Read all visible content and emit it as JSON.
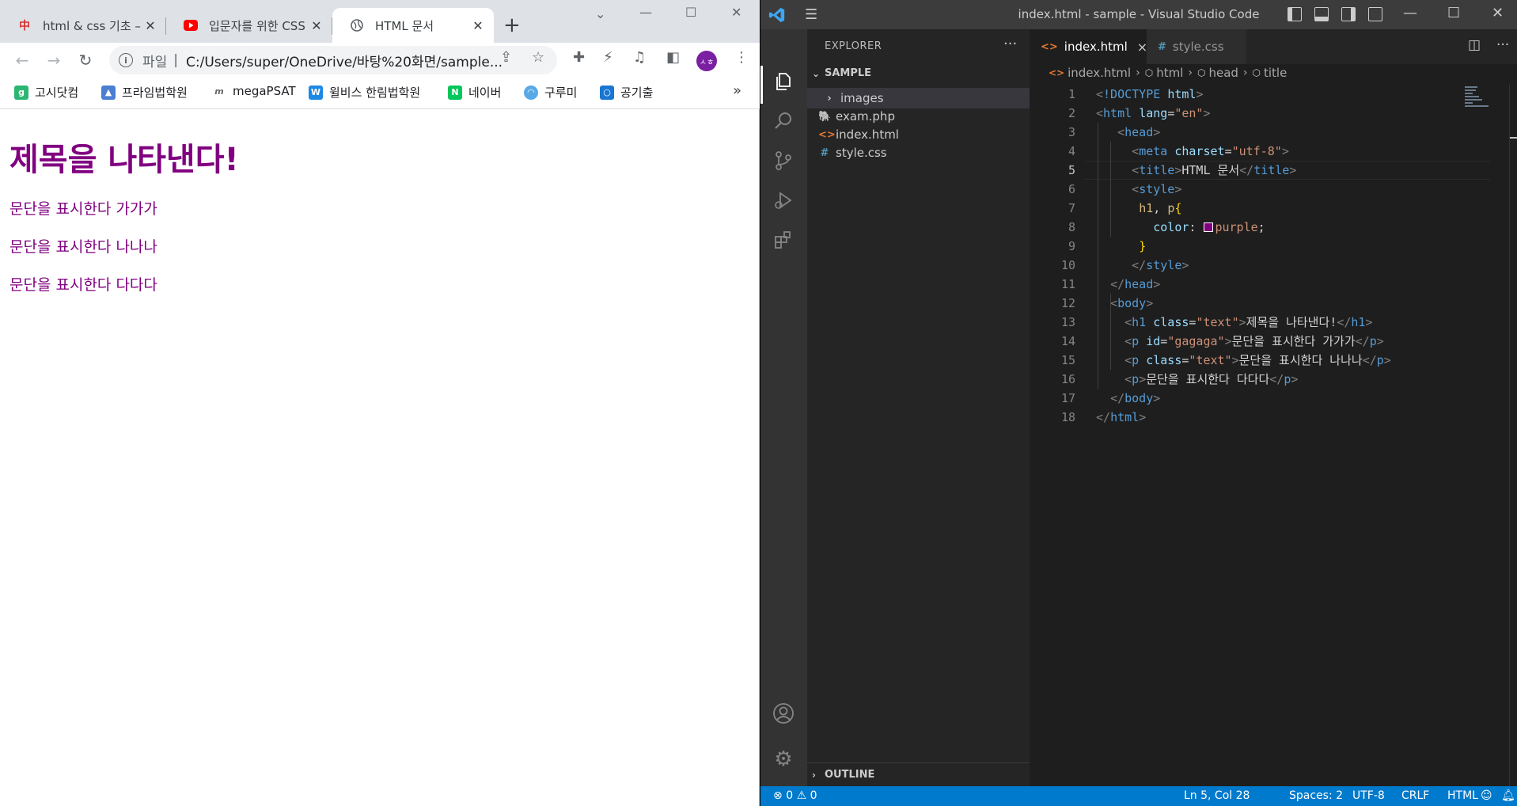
{
  "browser": {
    "tabs": [
      {
        "title": "html & css 기초 –",
        "favicon": "chinese-char-icon",
        "active": false
      },
      {
        "title": "입문자를 위한 CSS",
        "favicon": "youtube-icon",
        "active": false
      },
      {
        "title": "HTML 문서",
        "favicon": "globe-icon",
        "active": true
      }
    ],
    "address": {
      "scheme": "파일",
      "url": "C:/Users/super/OneDrive/바탕%20화면/sample..."
    },
    "avatar_text": "ㅅㅎ",
    "bookmarks": [
      {
        "label": "고시닷컴",
        "icon": "goshi-icon",
        "color": "#2bb673"
      },
      {
        "label": "프라임법학원",
        "icon": "prime-icon",
        "color": "#4a7fd1"
      },
      {
        "label": "megaPSAT",
        "icon": "mega-icon",
        "color": "#666666"
      },
      {
        "label": "윌비스 한림법학원",
        "icon": "willbes-icon",
        "color": "#1e88e5"
      },
      {
        "label": "네이버",
        "icon": "naver-icon",
        "color": "#03c75a"
      },
      {
        "label": "구루미",
        "icon": "gooroomee-icon",
        "color": "#5aa9e6"
      },
      {
        "label": "공기출",
        "icon": "gonggi-icon",
        "color": "#1976d2"
      }
    ],
    "bookmarks_more": "»",
    "page": {
      "heading": "제목을 나타낸다!",
      "paragraphs": [
        "문단을 표시한다 가가가",
        "문단을 표시한다 나나나",
        "문단을 표시한다 다다다"
      ],
      "text_color": "#800080"
    }
  },
  "vscode": {
    "window_title": "index.html - sample - Visual Studio Code",
    "explorer": {
      "title": "EXPLORER",
      "folder": "SAMPLE",
      "items": [
        {
          "label": "images",
          "type": "folder"
        },
        {
          "label": "exam.php",
          "type": "php"
        },
        {
          "label": "index.html",
          "type": "html"
        },
        {
          "label": "style.css",
          "type": "css"
        }
      ],
      "outline": "OUTLINE"
    },
    "tabs": [
      {
        "label": "index.html",
        "active": true,
        "close": "×"
      },
      {
        "label": "style.css",
        "active": false
      }
    ],
    "breadcrumb": [
      "index.html",
      "html",
      "head",
      "title"
    ],
    "line_numbers": [
      "1",
      "2",
      "3",
      "4",
      "5",
      "6",
      "7",
      "8",
      "9",
      "10",
      "11",
      "12",
      "13",
      "14",
      "15",
      "16",
      "17",
      "18"
    ],
    "statusbar": {
      "errors": "0",
      "warnings": "0",
      "position": "Ln 5, Col 28",
      "spaces": "Spaces: 2",
      "encoding": "UTF-8",
      "eol": "CRLF",
      "language": "HTML"
    }
  }
}
